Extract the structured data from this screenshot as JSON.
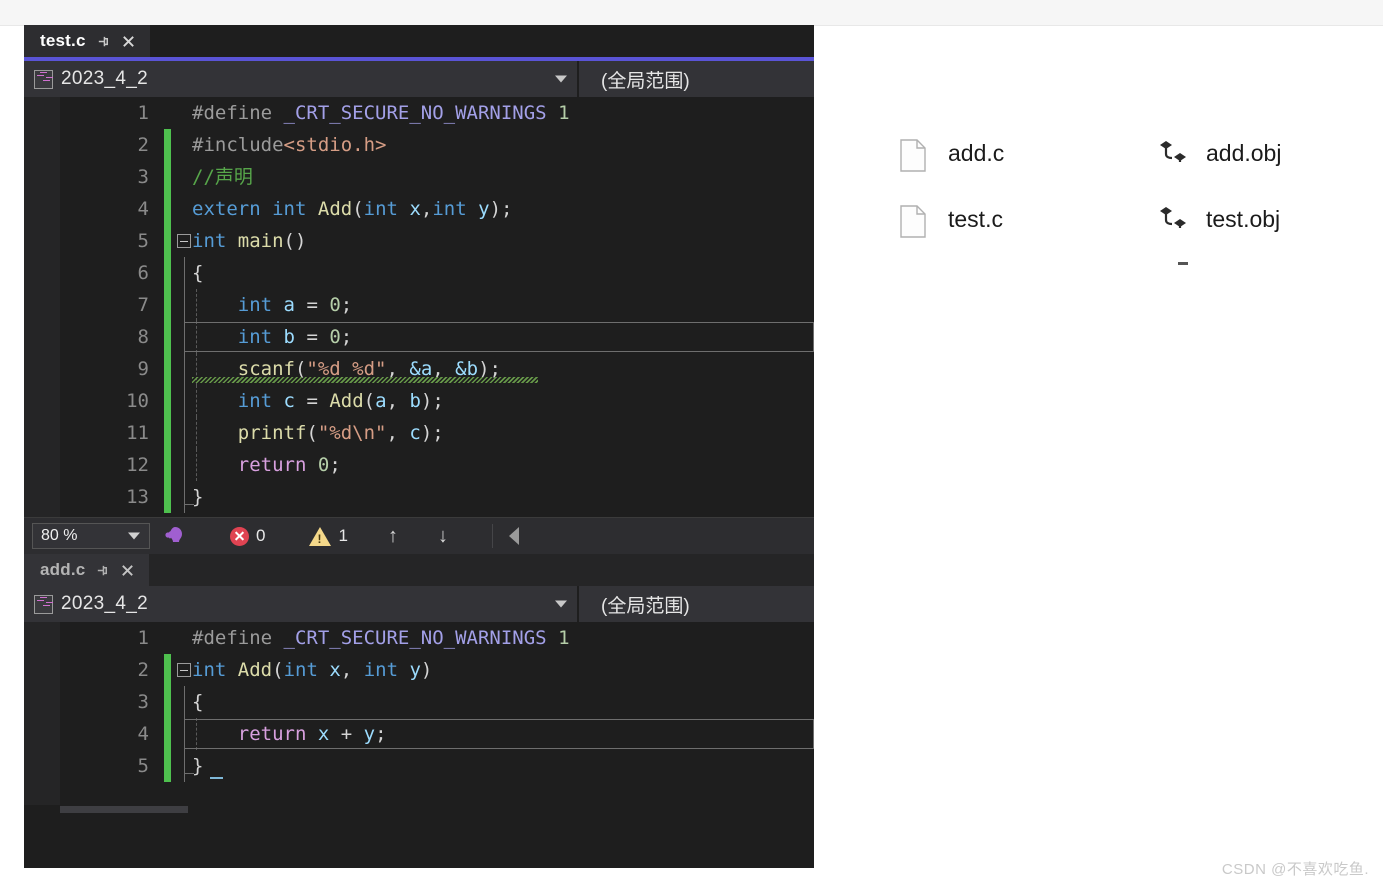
{
  "window": {
    "accent_color": "#5a54d6",
    "editor_bg": "#1e1e1e",
    "gutter_bg": "#252526"
  },
  "editor_top": {
    "tab": {
      "title": "test.c",
      "pin_icon": "pin-icon",
      "close_icon": "close-icon"
    },
    "navbar": {
      "project": "2023_4_2",
      "project_icon": "cpp-project-icon",
      "scope": "(全局范围)",
      "caret_icon": "chevron-down-icon"
    },
    "lines": [
      {
        "n": "1",
        "tokens": [
          {
            "t": "#define ",
            "c": "t-pre"
          },
          {
            "t": "_CRT_SECURE_NO_WARNINGS",
            "c": "t-macro"
          },
          {
            "t": " ",
            "c": "t-plain"
          },
          {
            "t": "1",
            "c": "t-num"
          }
        ]
      },
      {
        "n": "2",
        "tokens": [
          {
            "t": "#include",
            "c": "t-pre"
          },
          {
            "t": "<stdio.h>",
            "c": "t-hdr"
          }
        ]
      },
      {
        "n": "3",
        "tokens": [
          {
            "t": "//声明",
            "c": "t-cmt"
          }
        ]
      },
      {
        "n": "4",
        "tokens": [
          {
            "t": "extern",
            "c": "t-kw"
          },
          {
            "t": " ",
            "c": "t-plain"
          },
          {
            "t": "int",
            "c": "t-kw"
          },
          {
            "t": " ",
            "c": "t-plain"
          },
          {
            "t": "Add",
            "c": "t-fn"
          },
          {
            "t": "(",
            "c": "t-punc"
          },
          {
            "t": "int",
            "c": "t-kw"
          },
          {
            "t": " ",
            "c": "t-plain"
          },
          {
            "t": "x",
            "c": "t-var"
          },
          {
            "t": ",",
            "c": "t-punc"
          },
          {
            "t": "int",
            "c": "t-kw"
          },
          {
            "t": " ",
            "c": "t-plain"
          },
          {
            "t": "y",
            "c": "t-var"
          },
          {
            "t": ");",
            "c": "t-punc"
          }
        ]
      },
      {
        "n": "5",
        "tokens": [
          {
            "t": "int",
            "c": "t-kw"
          },
          {
            "t": " ",
            "c": "t-plain"
          },
          {
            "t": "main",
            "c": "t-fn"
          },
          {
            "t": "()",
            "c": "t-punc"
          }
        ]
      },
      {
        "n": "6",
        "tokens": [
          {
            "t": "{",
            "c": "t-punc"
          }
        ]
      },
      {
        "n": "7",
        "tokens": [
          {
            "t": "    ",
            "c": "t-plain"
          },
          {
            "t": "int",
            "c": "t-kw"
          },
          {
            "t": " ",
            "c": "t-plain"
          },
          {
            "t": "a",
            "c": "t-var"
          },
          {
            "t": " = ",
            "c": "t-punc"
          },
          {
            "t": "0",
            "c": "t-num"
          },
          {
            "t": ";",
            "c": "t-punc"
          }
        ]
      },
      {
        "n": "8",
        "tokens": [
          {
            "t": "    ",
            "c": "t-plain"
          },
          {
            "t": "int",
            "c": "t-kw"
          },
          {
            "t": " ",
            "c": "t-plain"
          },
          {
            "t": "b",
            "c": "t-var"
          },
          {
            "t": " = ",
            "c": "t-punc"
          },
          {
            "t": "0",
            "c": "t-num"
          },
          {
            "t": ";",
            "c": "t-punc"
          }
        ]
      },
      {
        "n": "9",
        "tokens": [
          {
            "t": "    ",
            "c": "t-plain"
          },
          {
            "t": "scanf",
            "c": "t-fn"
          },
          {
            "t": "(",
            "c": "t-punc"
          },
          {
            "t": "\"%d %d\"",
            "c": "t-str"
          },
          {
            "t": ", ",
            "c": "t-punc"
          },
          {
            "t": "&a",
            "c": "t-var"
          },
          {
            "t": ", ",
            "c": "t-punc"
          },
          {
            "t": "&b",
            "c": "t-var"
          },
          {
            "t": ");",
            "c": "t-punc"
          }
        ]
      },
      {
        "n": "10",
        "tokens": [
          {
            "t": "    ",
            "c": "t-plain"
          },
          {
            "t": "int",
            "c": "t-kw"
          },
          {
            "t": " ",
            "c": "t-plain"
          },
          {
            "t": "c",
            "c": "t-var"
          },
          {
            "t": " = ",
            "c": "t-punc"
          },
          {
            "t": "Add",
            "c": "t-fn"
          },
          {
            "t": "(",
            "c": "t-punc"
          },
          {
            "t": "a",
            "c": "t-var"
          },
          {
            "t": ", ",
            "c": "t-punc"
          },
          {
            "t": "b",
            "c": "t-var"
          },
          {
            "t": ");",
            "c": "t-punc"
          }
        ]
      },
      {
        "n": "11",
        "tokens": [
          {
            "t": "    ",
            "c": "t-plain"
          },
          {
            "t": "printf",
            "c": "t-fn"
          },
          {
            "t": "(",
            "c": "t-punc"
          },
          {
            "t": "\"%d\\n\"",
            "c": "t-str"
          },
          {
            "t": ", ",
            "c": "t-punc"
          },
          {
            "t": "c",
            "c": "t-var"
          },
          {
            "t": ");",
            "c": "t-punc"
          }
        ]
      },
      {
        "n": "12",
        "tokens": [
          {
            "t": "    ",
            "c": "t-plain"
          },
          {
            "t": "return",
            "c": "t-kw2"
          },
          {
            "t": " ",
            "c": "t-plain"
          },
          {
            "t": "0",
            "c": "t-num"
          },
          {
            "t": ";",
            "c": "t-punc"
          }
        ]
      },
      {
        "n": "13",
        "tokens": [
          {
            "t": "}",
            "c": "t-punc"
          }
        ]
      }
    ]
  },
  "status_bar": {
    "zoom": "80 %",
    "zoom_caret_icon": "chevron-down-icon",
    "intellisense_icon": "wrench-bulb-icon",
    "error_icon": "error-circle-icon",
    "error_count": "0",
    "warning_icon": "warning-triangle-icon",
    "warning_count": "1",
    "prev_icon": "arrow-up-icon",
    "next_icon": "arrow-down-icon",
    "collapse_icon": "chevron-left-icon",
    "prev_glyph": "↑",
    "next_glyph": "↓"
  },
  "editor_bottom": {
    "tab": {
      "title": "add.c",
      "pin_icon": "pin-icon",
      "close_icon": "close-icon"
    },
    "navbar": {
      "project": "2023_4_2",
      "project_icon": "cpp-project-icon",
      "scope": "(全局范围)",
      "caret_icon": "chevron-down-icon"
    },
    "lines": [
      {
        "n": "1",
        "tokens": [
          {
            "t": "#define ",
            "c": "t-pre"
          },
          {
            "t": "_CRT_SECURE_NO_WARNINGS",
            "c": "t-macro"
          },
          {
            "t": " ",
            "c": "t-plain"
          },
          {
            "t": "1",
            "c": "t-num"
          }
        ]
      },
      {
        "n": "2",
        "tokens": [
          {
            "t": "int",
            "c": "t-kw"
          },
          {
            "t": " ",
            "c": "t-plain"
          },
          {
            "t": "Add",
            "c": "t-fn"
          },
          {
            "t": "(",
            "c": "t-punc"
          },
          {
            "t": "int",
            "c": "t-kw"
          },
          {
            "t": " ",
            "c": "t-plain"
          },
          {
            "t": "x",
            "c": "t-var"
          },
          {
            "t": ", ",
            "c": "t-punc"
          },
          {
            "t": "int",
            "c": "t-kw"
          },
          {
            "t": " ",
            "c": "t-plain"
          },
          {
            "t": "y",
            "c": "t-var"
          },
          {
            "t": ")",
            "c": "t-punc"
          }
        ]
      },
      {
        "n": "3",
        "tokens": [
          {
            "t": "{",
            "c": "t-punc"
          }
        ]
      },
      {
        "n": "4",
        "tokens": [
          {
            "t": "    ",
            "c": "t-plain"
          },
          {
            "t": "return",
            "c": "t-kw2"
          },
          {
            "t": " ",
            "c": "t-plain"
          },
          {
            "t": "x",
            "c": "t-var"
          },
          {
            "t": " + ",
            "c": "t-punc"
          },
          {
            "t": "y",
            "c": "t-var"
          },
          {
            "t": ";",
            "c": "t-punc"
          }
        ]
      },
      {
        "n": "5",
        "tokens": [
          {
            "t": "}",
            "c": "t-punc"
          }
        ]
      }
    ]
  },
  "file_list": {
    "source_files": [
      {
        "name": "add.c",
        "icon": "document-icon"
      },
      {
        "name": "test.c",
        "icon": "document-icon"
      }
    ],
    "object_files": [
      {
        "name": "add.obj",
        "icon": "obj-file-icon"
      },
      {
        "name": "test.obj",
        "icon": "obj-file-icon"
      }
    ]
  },
  "watermark": {
    "text": "CSDN @不喜欢吃鱼."
  }
}
